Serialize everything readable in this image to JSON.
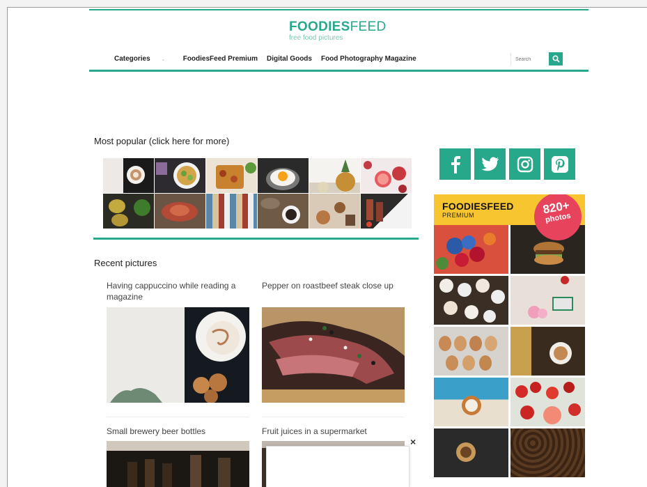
{
  "brand": {
    "name_bold": "FOODIES",
    "name_light": "FEED",
    "tagline": "free food pictures",
    "accent_color": "#27a88a"
  },
  "nav": {
    "items": [
      {
        "label": "Categories",
        "has_dropdown": true
      },
      {
        "label": "FoodiesFeed Premium"
      },
      {
        "label": "Digital Goods"
      },
      {
        "label": "Food Photography Magazine"
      }
    ],
    "search_placeholder": "Search"
  },
  "popular": {
    "heading": "Most popular (click here for more)"
  },
  "recent": {
    "heading": "Recent pictures",
    "posts": [
      {
        "title": "Having cappuccino while reading a magazine"
      },
      {
        "title": "Pepper on roastbeef steak close up"
      },
      {
        "title": "Small brewery beer bottles"
      },
      {
        "title": "Fruit juices in a supermarket"
      }
    ]
  },
  "social": {
    "icons": [
      "facebook-icon",
      "twitter-icon",
      "instagram-icon",
      "pinterest-icon"
    ]
  },
  "premium_banner": {
    "title": "FOODIESFEED",
    "subtitle": "PREMIUM",
    "badge_number": "820+",
    "badge_label": "photos",
    "badge_color": "#e8435c",
    "banner_color": "#f7c52f"
  },
  "overlay": {
    "close_label": "×"
  }
}
